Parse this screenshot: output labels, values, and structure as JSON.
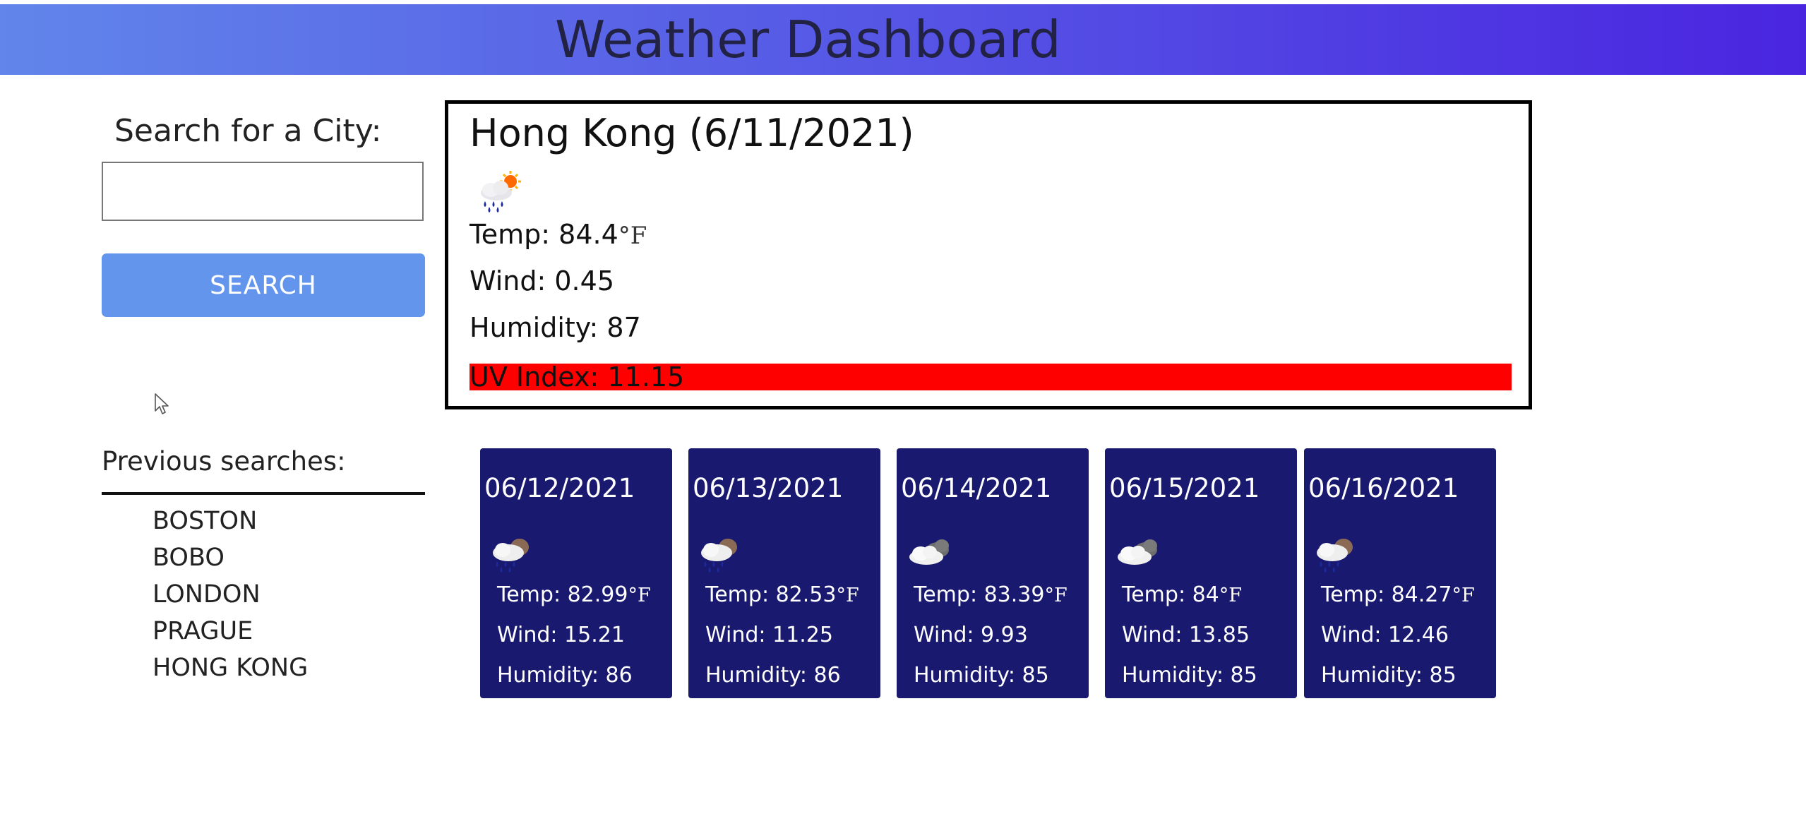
{
  "header": {
    "title": "Weather Dashboard",
    "background_from": "#6185ea",
    "background_to": "#4a25e0"
  },
  "search": {
    "label": "Search for a City:",
    "input_value": "",
    "button_label": "SEARCH"
  },
  "history": {
    "label": "Previous searches:",
    "items": [
      "BOSTON",
      "BOBO",
      "LONDON",
      "PRAGUE",
      "HONG KONG"
    ]
  },
  "current": {
    "title": "Hong Kong (6/11/2021)",
    "icon": "rain-with-sun-icon",
    "temp_label": "Temp: 84.4",
    "temp_unit": "°F",
    "wind": "Wind: 0.45",
    "humidity": "Humidity: 87",
    "uv": "UV Index: 11.15",
    "uv_color": "#ff0000"
  },
  "forecast": [
    {
      "date": "06/12/2021",
      "icon": "rain-icon",
      "temp": "Temp: 82.99",
      "unit": "°F",
      "wind": "Wind: 15.21",
      "humidity": "Humidity: 86"
    },
    {
      "date": "06/13/2021",
      "icon": "rain-icon",
      "temp": "Temp: 82.53",
      "unit": "°F",
      "wind": "Wind: 11.25",
      "humidity": "Humidity: 86"
    },
    {
      "date": "06/14/2021",
      "icon": "cloudy-icon",
      "temp": "Temp: 83.39",
      "unit": "°F",
      "wind": "Wind: 9.93",
      "humidity": "Humidity: 85"
    },
    {
      "date": "06/15/2021",
      "icon": "cloudy-icon",
      "temp": "Temp: 84",
      "unit": "°F",
      "wind": "Wind: 13.85",
      "humidity": "Humidity: 85"
    },
    {
      "date": "06/16/2021",
      "icon": "rain-icon",
      "temp": "Temp: 84.27",
      "unit": "°F",
      "wind": "Wind: 12.46",
      "humidity": "Humidity: 85"
    }
  ],
  "colors": {
    "card_background": "#191970",
    "button_background": "#6495ed"
  }
}
